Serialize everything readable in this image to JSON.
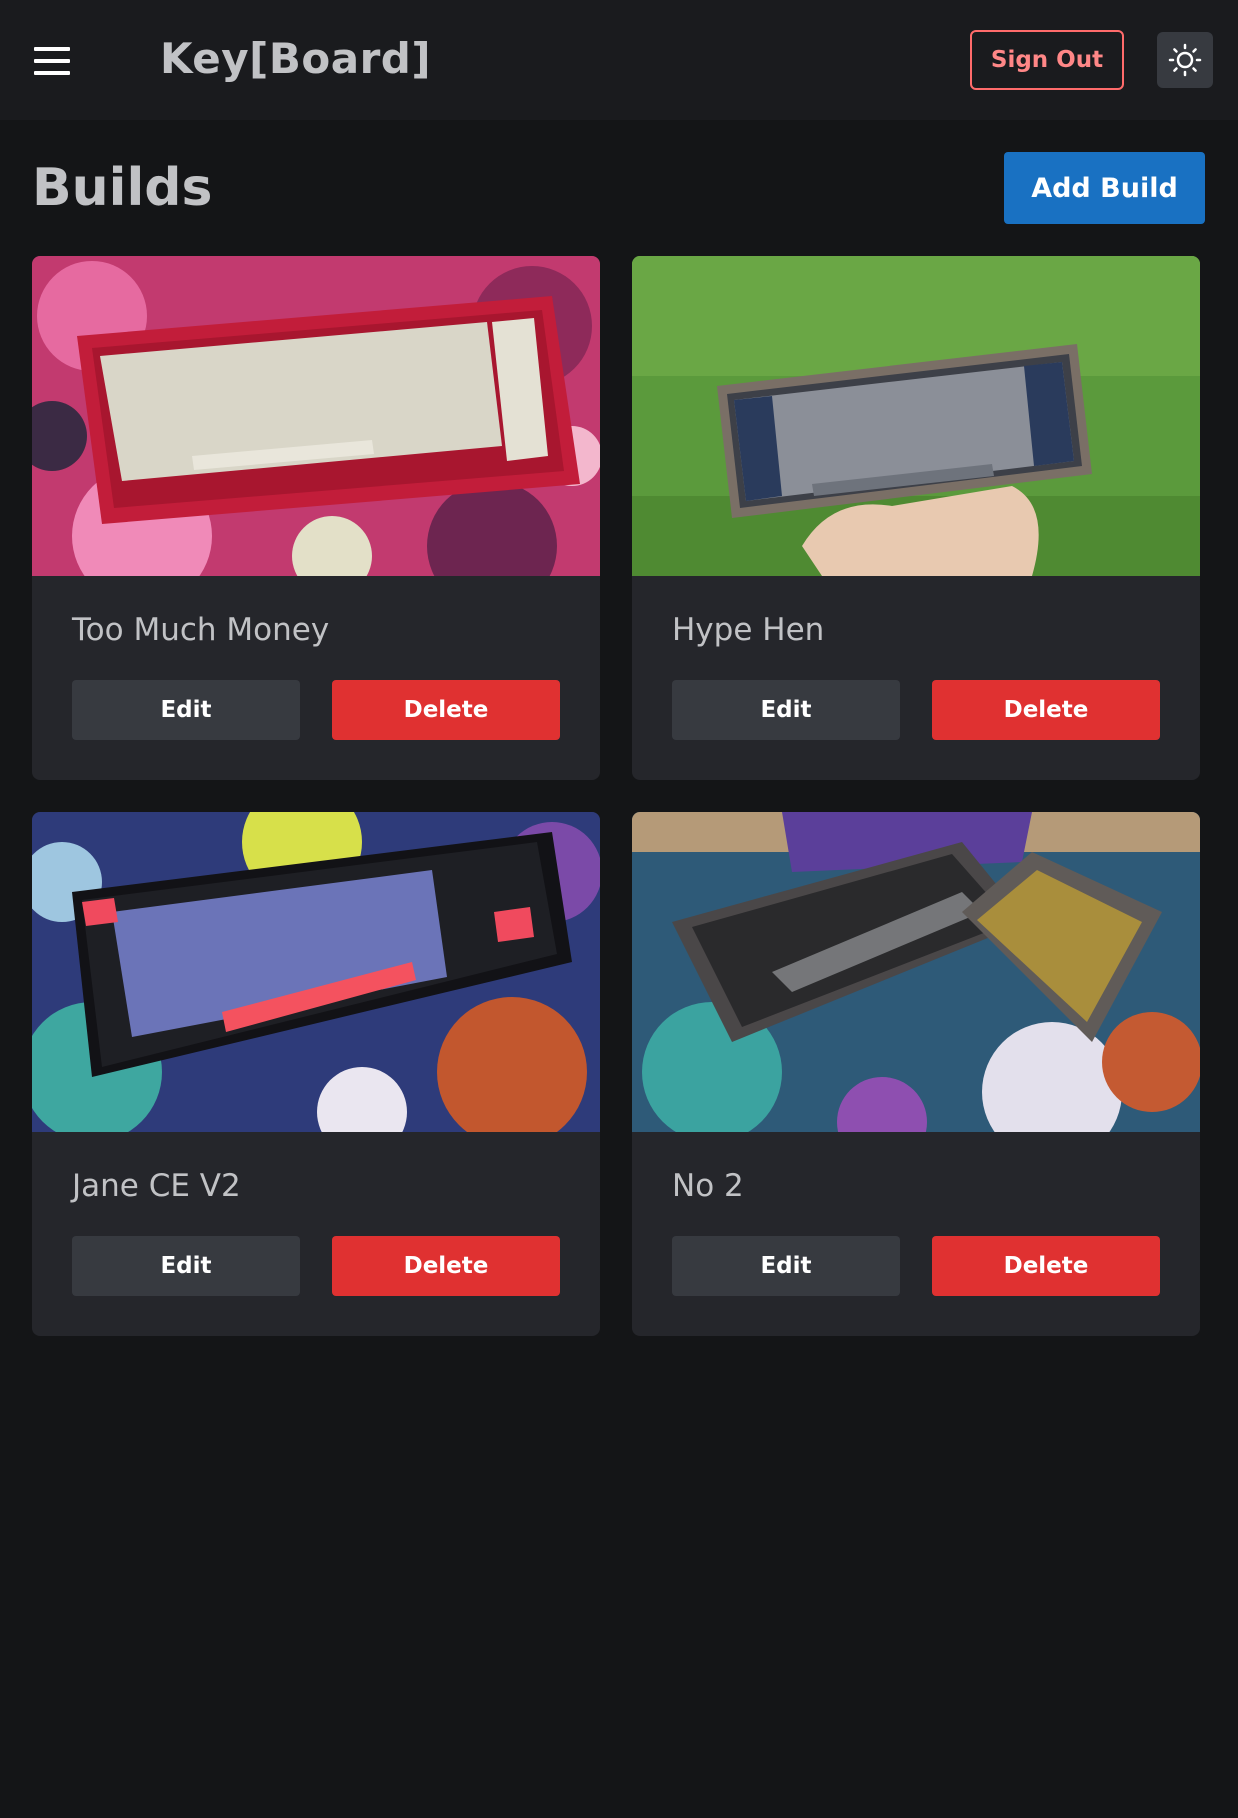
{
  "header": {
    "brand": "Key[Board]",
    "sign_out_label": "Sign Out",
    "menu_icon": "hamburger-menu-icon",
    "theme_icon": "sun-icon"
  },
  "page": {
    "title": "Builds",
    "add_build_label": "Add Build"
  },
  "builds": [
    {
      "name": "Too Much Money",
      "edit_label": "Edit",
      "delete_label": "Delete"
    },
    {
      "name": "Hype Hen",
      "edit_label": "Edit",
      "delete_label": "Delete"
    },
    {
      "name": "Jane CE V2",
      "edit_label": "Edit",
      "delete_label": "Delete"
    },
    {
      "name": "No 2",
      "edit_label": "Edit",
      "delete_label": "Delete"
    }
  ],
  "colors": {
    "background": "#141517",
    "card": "#25262b",
    "primary": "#1971c2",
    "danger": "#e03131",
    "sign_out": "#ff8787"
  }
}
